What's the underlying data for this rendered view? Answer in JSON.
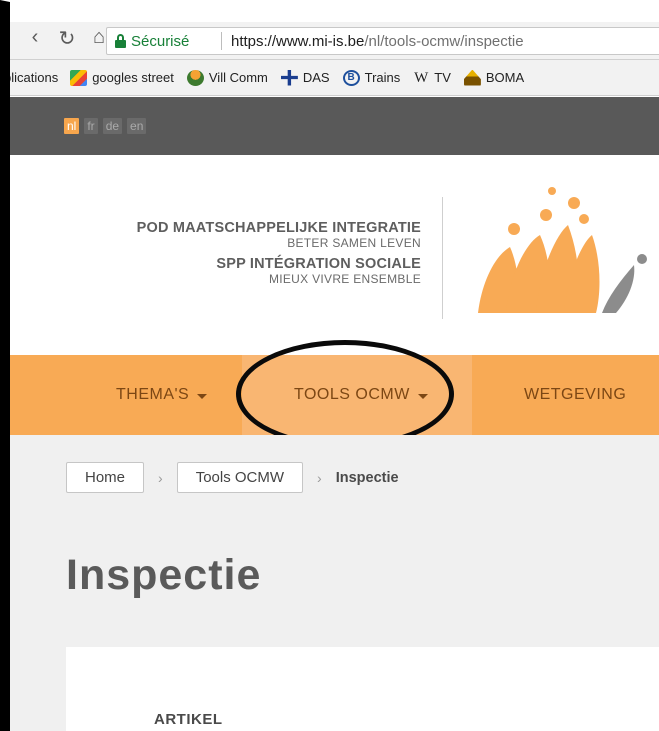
{
  "browser": {
    "nav_icons": [
      "back-arrow",
      "reload",
      "home"
    ],
    "secure_label": "Sécurisé",
    "url_host": "https://www.mi-is.be",
    "url_path": "/nl/tools-ocmw/inspectie",
    "bookmarks": [
      {
        "label": "plications",
        "icon": "apps-icon"
      },
      {
        "label": "googles street",
        "icon": "maps-icon"
      },
      {
        "label": "Vill Comm",
        "icon": "village-icon"
      },
      {
        "label": "DAS",
        "icon": "das-icon"
      },
      {
        "label": "Trains",
        "icon": "trains-icon"
      },
      {
        "label": "TV",
        "icon": "wikipedia-icon"
      },
      {
        "label": "BOMA",
        "icon": "boma-icon"
      }
    ],
    "wiki_glyph": "W",
    "trains_glyph": "B"
  },
  "site": {
    "languages": [
      {
        "code": "nl",
        "active": true
      },
      {
        "code": "fr",
        "active": false
      },
      {
        "code": "de",
        "active": false
      },
      {
        "code": "en",
        "active": false
      }
    ],
    "org": {
      "nl_name": "POD MAATSCHAPPELIJKE INTEGRATIE",
      "nl_tagline": "BETER SAMEN LEVEN",
      "fr_name": "SPP INTÉGRATION SOCIALE",
      "fr_tagline": "MIEUX VIVRE ENSEMBLE"
    },
    "colors": {
      "accent": "#f8aa55",
      "accent_active": "#f9b672",
      "dark_bar": "#595959",
      "nav_text": "#7c4714"
    },
    "nav": {
      "themas": "THEMA'S",
      "tools": "TOOLS OCMW",
      "wetgeving": "WETGEVING"
    },
    "breadcrumb": {
      "home": "Home",
      "tools": "Tools OCMW",
      "separator": "›",
      "current": "Inspectie"
    },
    "page_title": "Inspectie",
    "article_label": "ARTIKEL"
  }
}
